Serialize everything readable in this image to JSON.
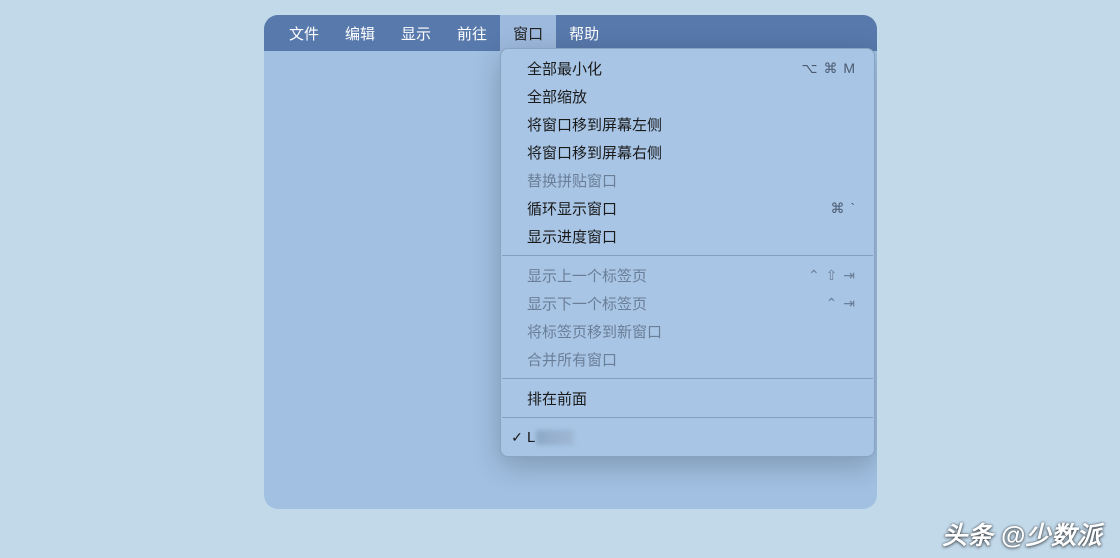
{
  "menubar": {
    "items": [
      {
        "label": "文件"
      },
      {
        "label": "编辑"
      },
      {
        "label": "显示"
      },
      {
        "label": "前往"
      },
      {
        "label": "窗口"
      },
      {
        "label": "帮助"
      }
    ],
    "active_index": 4
  },
  "dropdown": {
    "section1": [
      {
        "label": "全部最小化",
        "shortcut": "⌥ ⌘ M",
        "disabled": false
      },
      {
        "label": "全部缩放",
        "shortcut": "",
        "disabled": false
      },
      {
        "label": "将窗口移到屏幕左侧",
        "shortcut": "",
        "disabled": false
      },
      {
        "label": "将窗口移到屏幕右侧",
        "shortcut": "",
        "disabled": false
      },
      {
        "label": "替换拼贴窗口",
        "shortcut": "",
        "disabled": true
      },
      {
        "label": "循环显示窗口",
        "shortcut": "⌘ `",
        "disabled": false
      },
      {
        "label": "显示进度窗口",
        "shortcut": "",
        "disabled": false
      }
    ],
    "section2": [
      {
        "label": "显示上一个标签页",
        "shortcut": "⌃ ⇧ ⇥",
        "disabled": true
      },
      {
        "label": "显示下一个标签页",
        "shortcut": "⌃ ⇥",
        "disabled": true
      },
      {
        "label": "将标签页移到新窗口",
        "shortcut": "",
        "disabled": true
      },
      {
        "label": "合并所有窗口",
        "shortcut": "",
        "disabled": true
      }
    ],
    "section3": [
      {
        "label": "排在前面",
        "shortcut": "",
        "disabled": false
      }
    ],
    "checked": {
      "check": "✓",
      "label": "L"
    }
  },
  "watermark": "头条 @少数派"
}
